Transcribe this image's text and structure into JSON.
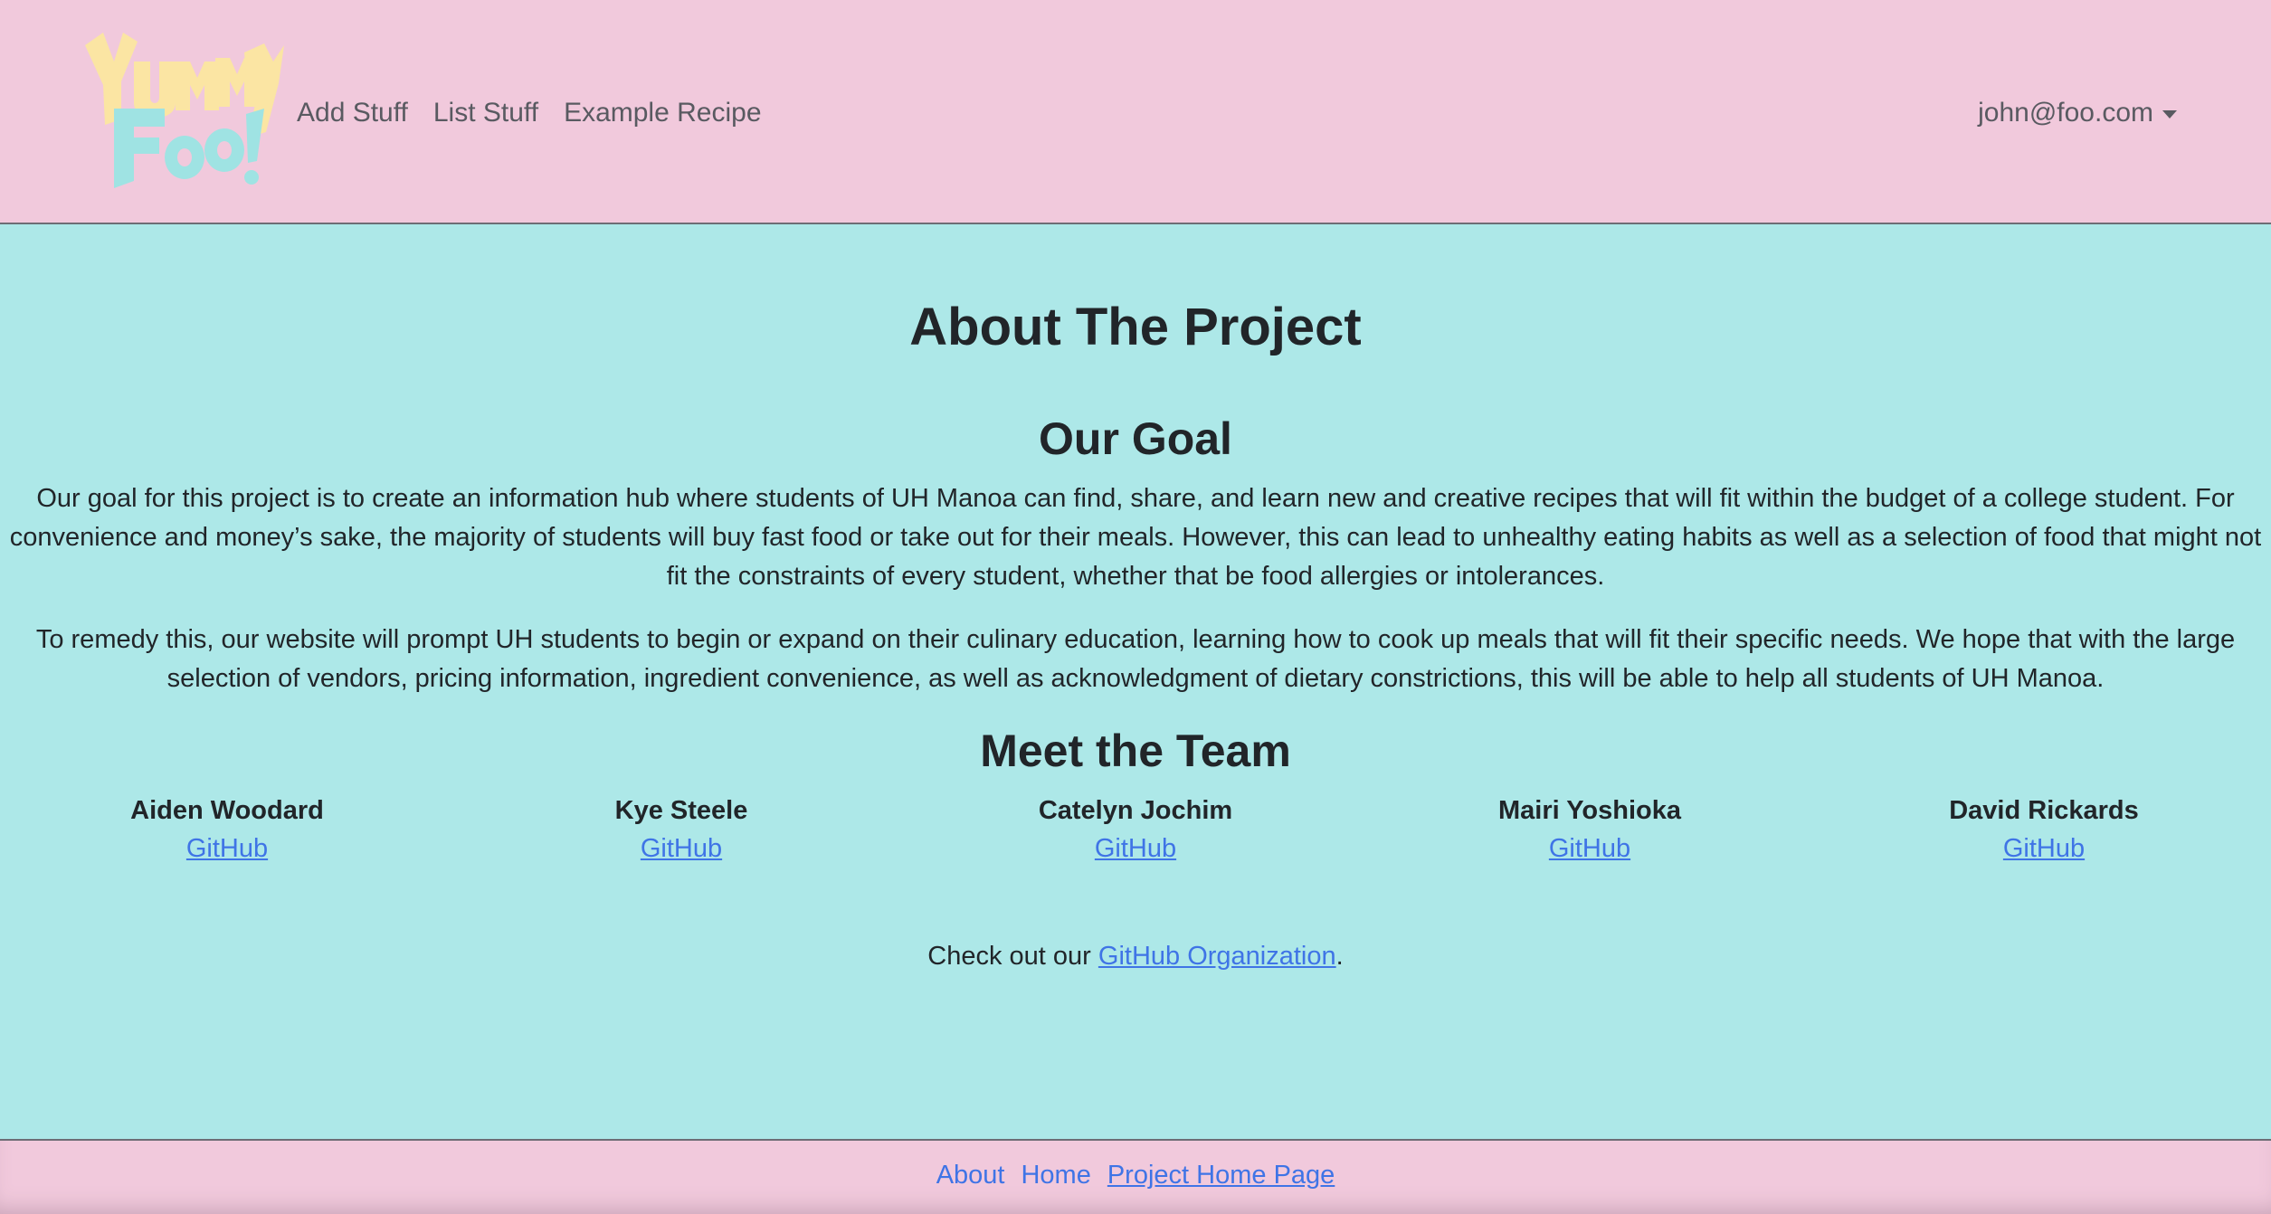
{
  "navbar": {
    "logo_alt": "Yummy Foo!",
    "links": [
      {
        "label": "Add Stuff"
      },
      {
        "label": "List Stuff"
      },
      {
        "label": "Example Recipe"
      }
    ],
    "user_email": "john@foo.com",
    "logo_colors": {
      "top": "#fbe5a3",
      "bottom": "#9fe3e3"
    }
  },
  "main": {
    "title": "About The Project",
    "goal_heading": "Our Goal",
    "paragraphs": [
      "Our goal for this project is to create an information hub where students of UH Manoa can find, share, and learn new and creative recipes that will fit within the budget of a college student. For convenience and money’s sake, the majority of students will buy fast food or take out for their meals. However, this can lead to unhealthy eating habits as well as a selection of food that might not fit the constraints of every student, whether that be food allergies or intolerances.",
      "To remedy this, our website will prompt UH students to begin or expand on their culinary education, learning how to cook up meals that will fit their specific needs. We hope that with the large selection of vendors, pricing information, ingredient convenience, as well as acknowledgment of dietary constrictions, this will be able to help all students of UH Manoa."
    ],
    "team_heading": "Meet the Team",
    "team": [
      {
        "name": "Aiden Woodard",
        "link": "GitHub"
      },
      {
        "name": "Kye Steele",
        "link": "GitHub"
      },
      {
        "name": "Catelyn Jochim",
        "link": "GitHub"
      },
      {
        "name": "Mairi Yoshioka",
        "link": "GitHub"
      },
      {
        "name": "David Rickards",
        "link": "GitHub"
      }
    ],
    "org_prefix": "Check out our ",
    "org_link": "GitHub Organization",
    "org_suffix": "."
  },
  "footer": {
    "links": [
      {
        "label": "About"
      },
      {
        "label": "Home"
      },
      {
        "label": "Project Home Page"
      }
    ]
  },
  "colors": {
    "header_bg": "#f1c9dc",
    "main_bg": "#ade8e8",
    "link": "#3f74e6"
  }
}
